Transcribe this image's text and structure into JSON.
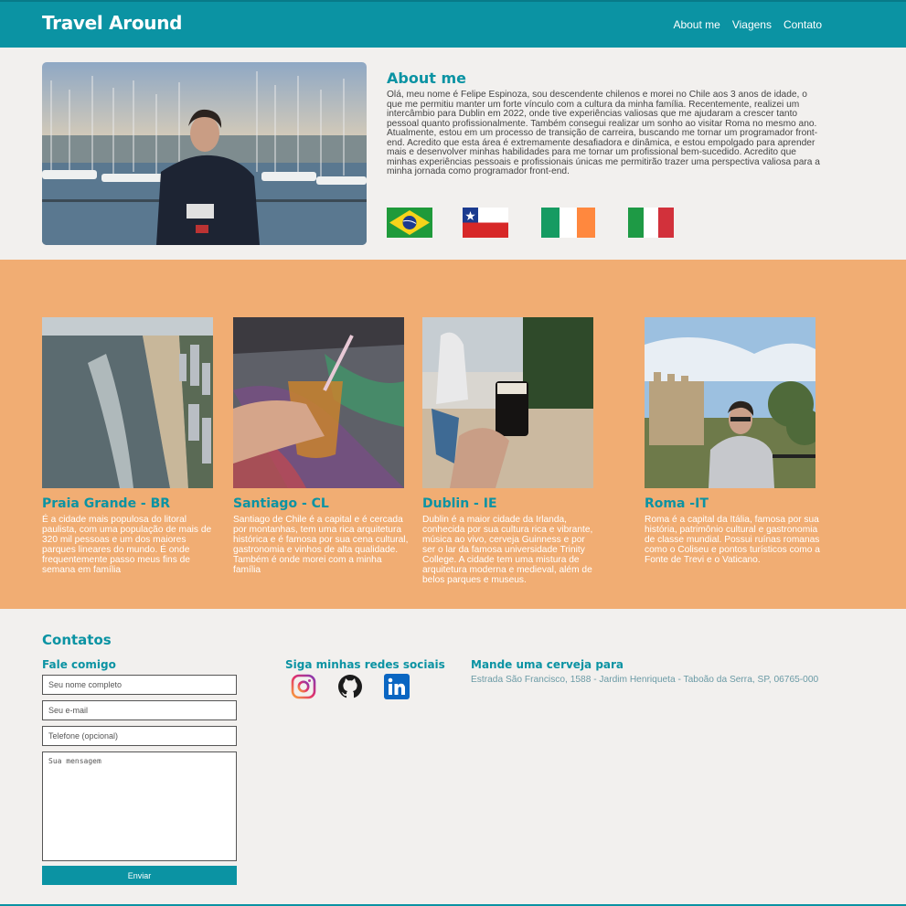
{
  "header": {
    "logo": "Travel Around",
    "nav": [
      "About me",
      "Viagens",
      "Contato"
    ]
  },
  "about": {
    "title": "About me",
    "text": "Olá, meu nome é Felipe Espinoza, sou descendente chilenos e morei no Chile aos 3 anos de idade, o que me permitiu manter um forte vínculo com a cultura da minha família. Recentemente, realizei um intercâmbio para Dublin em 2022, onde tive experiências valiosas que me ajudaram a crescer tanto pessoal quanto profissionalmente. Também consegui realizar um sonho ao visitar Roma no mesmo ano. Atualmente, estou em um processo de transição de carreira, buscando me tornar um programador front-end. Acredito que esta área é extremamente desafiadora e dinâmica, e estou empolgado para aprender mais e desenvolver minhas habilidades para me tornar um profissional bem-sucedido. Acredito que minhas experiências pessoais e profissionais únicas me permitirão trazer uma perspectiva valiosa para a minha jornada como programador front-end.",
    "flags": [
      "brazil-flag",
      "chile-flag",
      "ireland-flag",
      "italy-flag"
    ]
  },
  "trips": [
    {
      "title": "Praia Grande - BR",
      "text": "É a cidade mais populosa do litoral paulista, com uma população de mais de 320 mil pessoas e um dos maiores parques lineares do mundo. É onde frequentemente passo meus fins de semana em família"
    },
    {
      "title": "Santiago - CL",
      "text": "Santiago de Chile é a capital e é cercada por montanhas, tem uma rica arquitetura histórica e é famosa por sua cena cultural, gastronomia e vinhos de alta qualidade. Também é onde morei com a minha família"
    },
    {
      "title": "Dublin - IE",
      "text": "Dublin é a maior cidade da Irlanda, conhecida por sua cultura rica e vibrante, música ao vivo, cerveja Guinness e por ser o lar da famosa universidade Trinity College. A cidade tem uma mistura de arquitetura moderna e medieval, além de belos parques e museus."
    },
    {
      "title": "Roma -IT",
      "text": "Roma é a capital da Itália, famosa por sua história, patrimônio cultural e gastronomia de classe mundial. Possui ruínas romanas como o Coliseu e pontos turísticos como a Fonte de Trevi e o Vaticano."
    }
  ],
  "contacts": {
    "title": "Contatos",
    "form_title": "Fale comigo",
    "name_placeholder": "Seu nome completo",
    "email_placeholder": "Seu e-mail",
    "phone_placeholder": "Telefone (opcional)",
    "message_placeholder": "Sua mensagem",
    "send_label": "Enviar",
    "social_title": "Siga minhas redes sociais",
    "social_icons": [
      "instagram-icon",
      "github-icon",
      "linkedin-icon"
    ],
    "beer_title": "Mande uma cerveja para",
    "address": "Estrada São Francisco, 1588 - Jardim Henriqueta - Taboão da Serra, SP, 06765-000"
  },
  "colors": {
    "primary": "#0b93a3",
    "section_orange": "#f1ad73",
    "background": "#f2f0ee"
  }
}
